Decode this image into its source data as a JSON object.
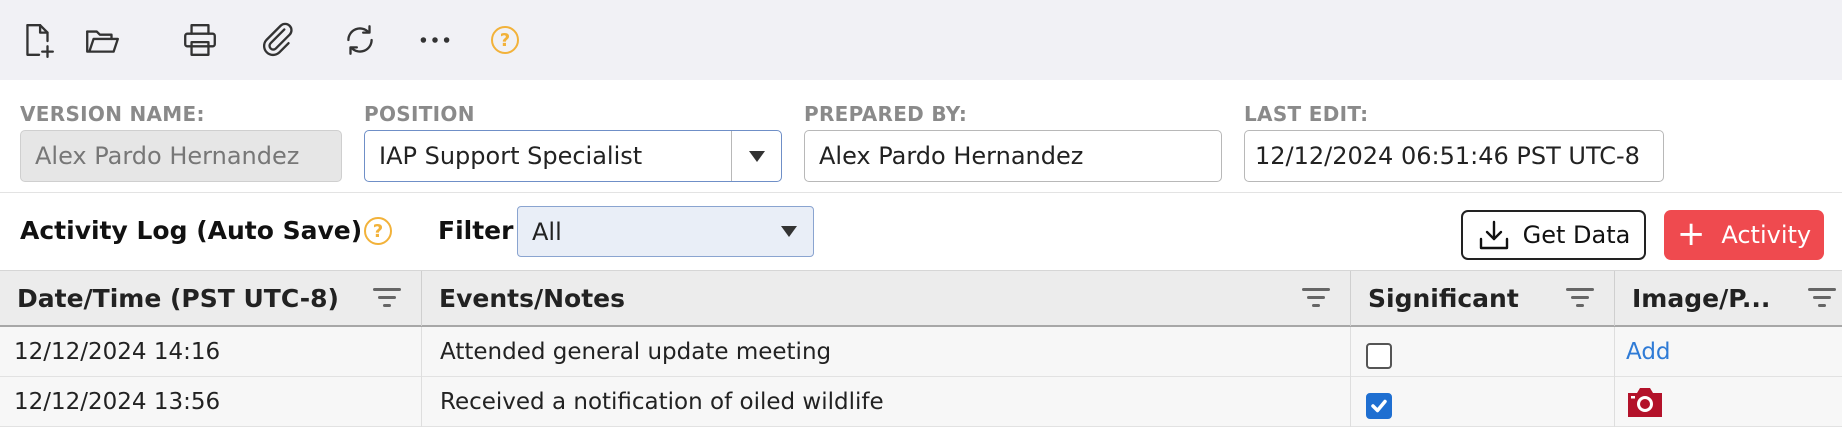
{
  "toolbar": {
    "icons": [
      "new-document-icon",
      "open-folder-icon",
      "print-icon",
      "attachment-icon",
      "refresh-icon",
      "more-icon",
      "help-icon"
    ],
    "help_glyph": "?"
  },
  "form": {
    "version_name_label": "VERSION NAME:",
    "version_name_value": "Alex Pardo Hernandez",
    "position_label": "POSITION",
    "position_value": "IAP Support Specialist",
    "prepared_by_label": "PREPARED BY:",
    "prepared_by_value": "Alex Pardo Hernandez",
    "last_edit_label": "LAST EDIT:",
    "last_edit_value": "12/12/2024 06:51:46 PST UTC-8"
  },
  "activity_log": {
    "title": "Activity Log (Auto Save)",
    "help_glyph": "?",
    "filter_label": "Filter",
    "filter_value": "All",
    "get_data_label": "Get Data",
    "add_activity_plus": "+",
    "add_activity_label": "Activity"
  },
  "table": {
    "columns": [
      "Date/Time (PST UTC-8)",
      "Events/Notes",
      "Significant",
      "Image/P..."
    ],
    "rows": [
      {
        "datetime": "12/12/2024 14:16",
        "event": "Attended general update meeting",
        "significant": false,
        "image": "Add"
      },
      {
        "datetime": "12/12/2024 13:56",
        "event": "Received a notification of oiled wildlife",
        "significant": true,
        "image": "camera-icon"
      }
    ]
  },
  "colors": {
    "accent_red": "#ef4a4f",
    "help_orange": "#f2b23a",
    "link_blue": "#2f7bd6",
    "checkbox_blue": "#1f6fd1",
    "camera_red": "#b3122a"
  }
}
